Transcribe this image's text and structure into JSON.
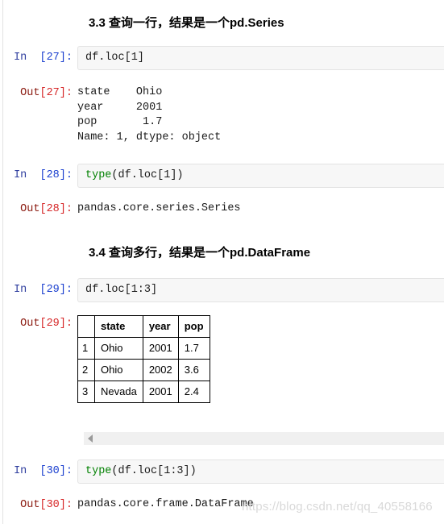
{
  "watermark": "https://blog.csdn.net/qq_40558166",
  "colors": {
    "in_prompt": "#303F9F",
    "out_prompt": "#8b1a10",
    "in_index": "#1a3fcf",
    "out_index": "#d62728",
    "builtin_token": "#008000",
    "input_bg": "#f7f7f7",
    "input_border": "#e3e3e3",
    "scrollbar_bg": "#f0f0f0",
    "scrollbar_arrow": "#9a9a9a"
  },
  "headings": {
    "h33": "3.3 查询一行，结果是一个pd.Series",
    "h34": "3.4 查询多行，结果是一个pd.DataFrame"
  },
  "cells": {
    "in27": {
      "prompt_label": "In",
      "prompt_index": "[27]:",
      "code": "df.loc[1]"
    },
    "out27": {
      "prompt_label": "Out",
      "prompt_index": "[27]:",
      "text": "state    Ohio\nyear     2001\npop       1.7\nName: 1, dtype: object"
    },
    "in28": {
      "prompt_label": "In",
      "prompt_index": "[28]:",
      "code_builtin": "type",
      "code_rest": "(df.loc[1])"
    },
    "out28": {
      "prompt_label": "Out",
      "prompt_index": "[28]:",
      "text": "pandas.core.series.Series"
    },
    "in29": {
      "prompt_label": "In",
      "prompt_index": "[29]:",
      "code": "df.loc[1:3]"
    },
    "out29": {
      "prompt_label": "Out",
      "prompt_index": "[29]:"
    },
    "in30": {
      "prompt_label": "In",
      "prompt_index": "[30]:",
      "code_builtin": "type",
      "code_rest": "(df.loc[1:3])"
    },
    "out30": {
      "prompt_label": "Out",
      "prompt_index": "[30]:",
      "text": "pandas.core.frame.DataFrame"
    }
  },
  "dataframe": {
    "index_header": "",
    "columns": [
      "state",
      "year",
      "pop"
    ],
    "rows": [
      {
        "index": "1",
        "state": "Ohio",
        "year": "2001",
        "pop": "1.7"
      },
      {
        "index": "2",
        "state": "Ohio",
        "year": "2002",
        "pop": "3.6"
      },
      {
        "index": "3",
        "state": "Nevada",
        "year": "2001",
        "pop": "2.4"
      }
    ]
  },
  "scrollbar": {
    "arrow_icon": "triangle-left-icon"
  }
}
